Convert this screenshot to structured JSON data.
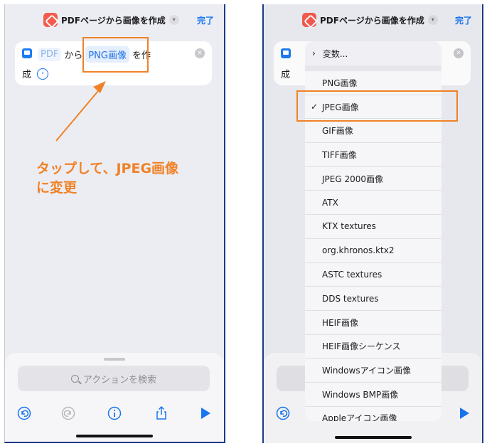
{
  "header": {
    "title": "PDFページから画像を作成",
    "done_label": "完了"
  },
  "action": {
    "input_token": "PDF",
    "connector": "から",
    "format_token": "PNG画像",
    "verb_part1": "を作",
    "verb_part2": "成"
  },
  "annotation": {
    "line1": "タップして、JPEG画像",
    "line2": "に変更"
  },
  "search": {
    "placeholder": "アクションを検索"
  },
  "dropdown": {
    "variable_label": "変数...",
    "items": [
      {
        "label": "PNG画像",
        "checked": false
      },
      {
        "label": "JPEG画像",
        "checked": true
      },
      {
        "label": "GIF画像",
        "checked": false
      },
      {
        "label": "TIFF画像",
        "checked": false
      },
      {
        "label": "JPEG 2000画像",
        "checked": false
      },
      {
        "label": "ATX",
        "checked": false
      },
      {
        "label": "KTX textures",
        "checked": false
      },
      {
        "label": "org.khronos.ktx2",
        "checked": false
      },
      {
        "label": "ASTC textures",
        "checked": false
      },
      {
        "label": "DDS textures",
        "checked": false
      },
      {
        "label": "HEIF画像",
        "checked": false
      },
      {
        "label": "HEIF画像シーケンス",
        "checked": false
      },
      {
        "label": "Windowsアイコン画像",
        "checked": false
      },
      {
        "label": "Windows BMP画像",
        "checked": false
      },
      {
        "label": "Appleアイコン画像",
        "checked": false
      }
    ]
  },
  "icons": {
    "app": "shortcuts-app-icon",
    "undo": "undo-icon",
    "redo": "redo-icon",
    "info": "info-icon",
    "share": "share-icon",
    "play": "play-icon"
  },
  "colors": {
    "accent": "#1976f0",
    "highlight": "#f08226",
    "app_icon": "#f45b4f"
  }
}
